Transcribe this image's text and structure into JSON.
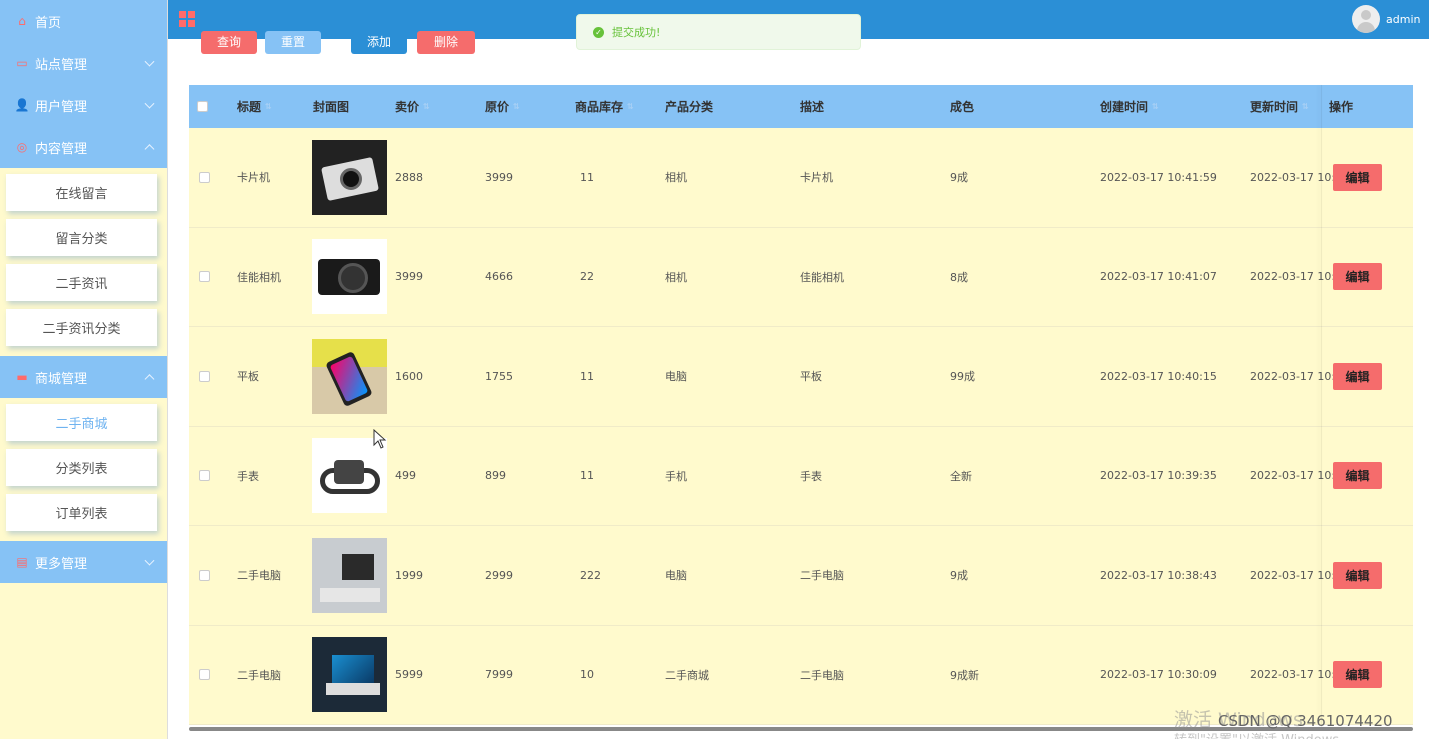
{
  "sidebar": {
    "home": "首页",
    "site_mgmt": "站点管理",
    "user_mgmt": "用户管理",
    "content_mgmt": "内容管理",
    "content_items": [
      "在线留言",
      "留言分类",
      "二手资讯",
      "二手资讯分类"
    ],
    "mall_mgmt": "商城管理",
    "mall_items": [
      "二手商城",
      "分类列表",
      "订单列表"
    ],
    "more_mgmt": "更多管理"
  },
  "topbar": {
    "username": "admin"
  },
  "toast": {
    "message": "提交成功!"
  },
  "toolbar": {
    "query": "查询",
    "reset": "重置",
    "add": "添加",
    "delete": "删除"
  },
  "table": {
    "headers": {
      "title": "标题",
      "cover": "封面图",
      "price": "卖价",
      "orig_price": "原价",
      "stock": "商品库存",
      "category": "产品分类",
      "desc": "描述",
      "condition": "成色",
      "created": "创建时间",
      "updated": "更新时间",
      "ops": "操作"
    },
    "edit_label": "编辑",
    "rows": [
      {
        "title": "卡片机",
        "price": "2888",
        "orig": "3999",
        "stock": "11",
        "category": "相机",
        "desc": "卡片机",
        "condition": "9成",
        "created": "2022-03-17 10:41:59",
        "updated": "2022-03-17 10:"
      },
      {
        "title": "佳能相机",
        "price": "3999",
        "orig": "4666",
        "stock": "22",
        "category": "相机",
        "desc": "佳能相机",
        "condition": "8成",
        "created": "2022-03-17 10:41:07",
        "updated": "2022-03-17 10:"
      },
      {
        "title": "平板",
        "price": "1600",
        "orig": "1755",
        "stock": "11",
        "category": "电脑",
        "desc": "平板",
        "condition": "99成",
        "created": "2022-03-17 10:40:15",
        "updated": "2022-03-17 10:"
      },
      {
        "title": "手表",
        "price": "499",
        "orig": "899",
        "stock": "11",
        "category": "手机",
        "desc": "手表",
        "condition": "全新",
        "created": "2022-03-17 10:39:35",
        "updated": "2022-03-17 10:"
      },
      {
        "title": "二手电脑",
        "price": "1999",
        "orig": "2999",
        "stock": "222",
        "category": "电脑",
        "desc": "二手电脑",
        "condition": "9成",
        "created": "2022-03-17 10:38:43",
        "updated": "2022-03-17 10:"
      },
      {
        "title": "二手电脑",
        "price": "5999",
        "orig": "7999",
        "stock": "10",
        "category": "二手商城",
        "desc": "二手电脑",
        "condition": "9成新",
        "created": "2022-03-17 10:30:09",
        "updated": "2022-03-17 10:"
      }
    ]
  },
  "watermark": {
    "windows": "激活 Windows",
    "csdn": "CSDN @Q 3461074420",
    "windows_sub": "转到\"设置\"以激活 Windows"
  },
  "colors": {
    "sidebar_bg": "#fffacd",
    "nav_blue": "#86c2f5",
    "topbar": "#2b8fd6",
    "danger": "#f56c6c",
    "success": "#67c23a"
  }
}
